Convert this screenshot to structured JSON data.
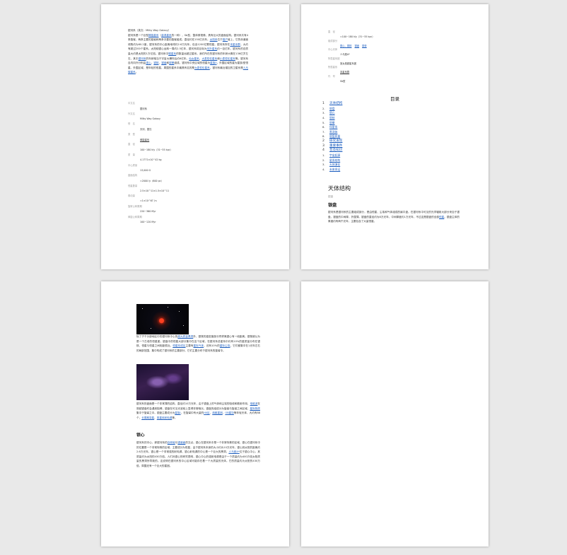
{
  "page1": {
    "intro": {
      "title_line": "银河系（英文：Milky Way Galaxy）",
      "p1a": "银河系是一个巨型",
      "p1_link1": "棒旋星系",
      "p1b": "（",
      "p1_link2": "漩涡星系",
      "p1c": "的一种），Sb型，整体俯视像，具有巨大的盘面结构。银河系共有4条旋臂，两条主要的旋臂和两条次要的旋臂组成。直径约在150亿光年。",
      "p1_link3": "太阳系",
      "p1d": "位于",
      "p1_link4": "猎户",
      "p1e": "臂上，它的赤道面倾角约为60.2度，银河系的中心距离地球约2.6万光年。包含1200亿颗恒星。银河系所在",
      "p1_link5": "本星系群",
      "p1f": "，大约有超过200个星系。太阳绕银心运转一周约2.5亿年，银河系将目标为",
      "p1_link6": "河外星系",
      "p1g": "约一百亿年。银河系的总质量大约是太阳的1万亿倍。银河系中",
      "p1_link7": "矮星系",
      "p1h": "的数量远超过星系。我们所在的银河系的年龄大概在136亿岁左右，其中",
      "p1_link8": "银河系",
      "p1i": "的年龄相当于宇宙大爆炸后约6亿年。",
      "p1_link9": "仙女星系",
      "p1j": "、",
      "p1_link10": "大麦哲伦星系",
      "p1k": "和",
      "p1_link11": "小麦哲伦星系",
      "p1l": "等。银河系自内向外分别由",
      "p1_link12": "银心",
      "p1m": "、",
      "p1_link13": "银核",
      "p1n": "、",
      "p1_link14": "银盘",
      "p1o": "和",
      "p1_link15": "银晕",
      "p1p": "组成。银河系中央区域的恒星为",
      "p1_link16": "星族II",
      "p1q": "，外围区域的星为星族I型恒星。外围区域，是年轻的恒星。周围的星系中最具有名的是",
      "p1_link17": "大麦哲伦星系",
      "p1r": "，银河系最近增加的卫星系是",
      "p1_link18": "人马矮星系",
      "p1s": "。"
    },
    "meta": [
      {
        "label": "中文名",
        "value": "银河系"
      },
      {
        "label": "外文名",
        "value": "Milky Way Galaxy"
      },
      {
        "label": "别　名",
        "value": "天河、银汉"
      },
      {
        "label": "类　型",
        "value": "棒旋星系",
        "link": true
      },
      {
        "label": "直　径",
        "value": "100~180 kly（31~55 kpc）"
      },
      {
        "label": "质　量",
        "value": "4.1771×10^42 kg"
      },
      {
        "label": "中心质量",
        "value": "13,000 G"
      },
      {
        "label": "盘面结构",
        "value": "≈2000 ly（600 pc）"
      },
      {
        "label": "恒星数量",
        "value": "2.5×10^11±1.5×10^11"
      },
      {
        "label": "角动量",
        "value": "≈1×10^67 J·s"
      },
      {
        "label": "旋臂公转周期",
        "value": "220~360 Myr"
      },
      {
        "label": "棒旋公转周期",
        "value": "100~120 Myr"
      }
    ]
  },
  "page2": {
    "meta": [
      {
        "label": "直　径",
        "value": "≈100~180 kly（31~55 kpc）"
      },
      {
        "label": "组成部分",
        "values": [
          "银心、银核",
          "银盘",
          "银晕"
        ]
      },
      {
        "label": "中心天体",
        "value": "人马座A*"
      },
      {
        "label": "所属星系团",
        "value": "室女座超星系团"
      },
      {
        "label": "所属星系",
        "value": "本星系群",
        "link": true
      },
      {
        "label": "代　号",
        "value": "Sb型"
      }
    ],
    "toc_title": "目录",
    "toc": [
      {
        "num": "1",
        "label": "天体结构",
        "level": 1
      },
      {
        "num": "2.",
        "label": "银盘",
        "level": 2
      },
      {
        "num": "3.",
        "label": "银心",
        "level": 2
      },
      {
        "num": "4.",
        "label": "银核",
        "level": 2
      },
      {
        "num": "5.",
        "label": "银晕",
        "level": 2
      },
      {
        "num": "6.",
        "label": "伴星系",
        "level": 2
      },
      {
        "num": "7.",
        "label": "黑洞体",
        "level": 2
      },
      {
        "num": "8.",
        "label": "银盘质量",
        "level": 2
      },
      {
        "num": "2",
        "label": "研究发现",
        "level": 1
      },
      {
        "num": "3",
        "label": "重要事件",
        "level": 1
      },
      {
        "num": "4",
        "label": "普及知识",
        "level": 1
      },
      {
        "num": "1.",
        "label": "宇宙起源",
        "level": 2
      },
      {
        "num": "2.",
        "label": "星系结构",
        "level": 2
      },
      {
        "num": "3.",
        "label": "天体演化",
        "level": 2
      },
      {
        "num": "4.",
        "label": "未来命运",
        "level": 2
      }
    ],
    "heading": "天体结构",
    "subheading_small": "银盘",
    "subheading": "银盘",
    "para": {
      "a": "银河系是银河系的主要组成部分，是由恒星、尘埃和气体组成的扁平盘。在银河系中可见的光学辐射大部分来自于银盘，银盘的中间厚，外围薄。银盘的直径约为8万光年，中间厚度约1万光年，不过这是银盘的全部",
      "link": "恒星",
      "b": "。银盘主体的厚度约有两千光年，主要包含了大量恒星。"
    }
  },
  "page3": {
    "para1": {
      "a": "除了子干分部地区中的银河系中心的",
      "link1": "超大质量黑洞",
      "b": "外，银核的高密度部分同样离银心有一段距离。银核被认为是一个古老的恒星团，银盘中的恒星大部分集中在这个区域，在银河系总星系中约有10%的星质量分布在银核，恒星与恒星之间相距很近。",
      "link2": "恒星形成区",
      "c": "主要有",
      "link3": "星际气体",
      "d": "，还有10%的",
      "link4": "星际尘埃",
      "e": "，它们都集中在1光年左右的局部范围，集中构成了银河系的主要部分。它们主要分布于银河系的旋臂中。"
    },
    "para2": {
      "a": "银河系的盘面是一个非常薄的结构，直径约10万光年，由于银盘上的气体和尘埃的吸收和散射作用，",
      "link1": "电磁波",
      "b": "在穿越银盘时会遇到阻碍，银盘在可见光波段上显得非常暗淡。银盘的组成分为旋臂与旋臂之间区域，",
      "link2": "星际物质",
      "c": "集中于旋臂之中。银盘主要成分为",
      "link3": "星族I",
      "d": "，在旋臂中有大量的",
      "link4": "HII区",
      "e": "、",
      "link5": "疏散星团",
      "f": "、",
      "link6": "OB星协",
      "g": "等年轻天体，大约有88个，",
      "link7": "长周期变星",
      "h": "、",
      "link8": "类星体射电源",
      "i": "等。"
    },
    "subheading": "银心",
    "para3": {
      "a": "银河系的中心，即银河系的",
      "link1": "自转轴",
      "b": "与",
      "link2": "银道面",
      "c": "的交点。银心在银河系中是一个非常特殊的区域，银心在银河系中的位置是一个非常特殊的区域，主要成分为恒星，由于银河系本身的大小约为10万光年，银心到太阳的距离约2.6万光年。银心是一个非常强的射电源，银心射电源的中心是一个巨大的黑洞，",
      "link3": "人马座A*",
      "d": "位于银心中心，其质量约为太阳的430万倍。人们对银心的研究表明，银心中心的强射电源是由于一个质量约为400万倍太阳质量的黑洞所导致的。这说明在银河系的中心区域可能存在着一个大质量的天体。它的质量约为太阳的430万倍，周围还有一个巨大的星团。"
    }
  }
}
